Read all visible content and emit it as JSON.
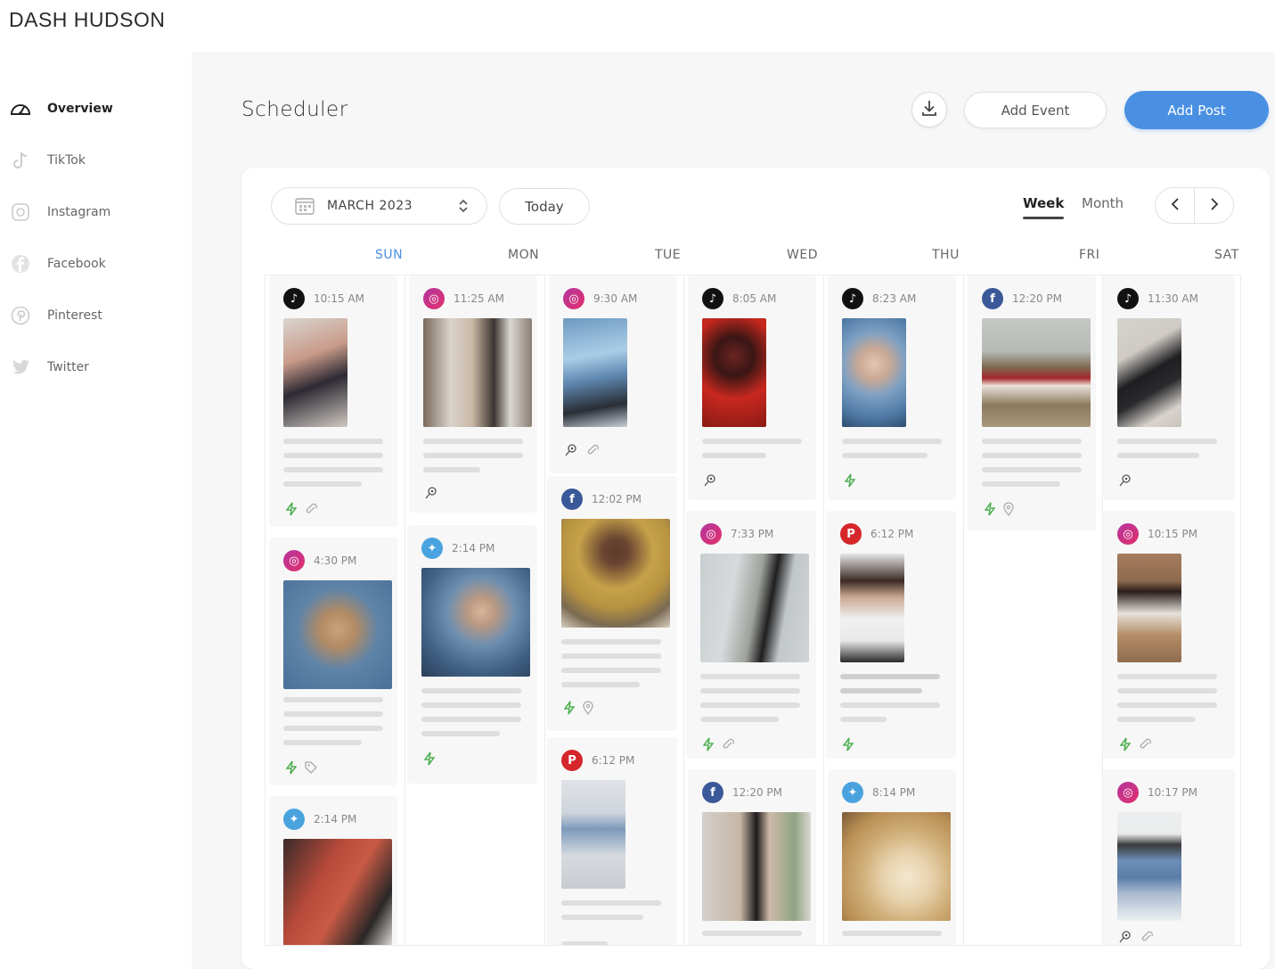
{
  "brand": "DASH HUDSON",
  "colors": {
    "accent": "#4a90e2",
    "tiktok": "#111111",
    "instagram": "#c13584",
    "facebook": "#3b5998",
    "twitter": "#4aa3df",
    "pinterest": "#d5262c",
    "boost": "#4caf50"
  },
  "sidebar": {
    "items": [
      {
        "label": "Overview",
        "icon": "dashboard-gauge-icon"
      },
      {
        "label": "TikTok",
        "icon": "tiktok-icon"
      },
      {
        "label": "Instagram",
        "icon": "instagram-icon"
      },
      {
        "label": "Facebook",
        "icon": "facebook-icon"
      },
      {
        "label": "Pinterest",
        "icon": "pinterest-icon"
      },
      {
        "label": "Twitter",
        "icon": "twitter-icon"
      }
    ]
  },
  "header": {
    "title": "Scheduler",
    "download_icon": "download-icon",
    "add_event": "Add Event",
    "add_post": "Add Post"
  },
  "toolbar": {
    "month": "MARCH 2023",
    "today": "Today",
    "week": "Week",
    "month_view": "Month"
  },
  "days": [
    "SUN",
    "MON",
    "TUE",
    "WED",
    "THU",
    "FRI",
    "SAT"
  ],
  "posts": {
    "sun": [
      {
        "platform": "tiktok",
        "time": "10:15 AM",
        "image": "couple-fashion-photo"
      },
      {
        "platform": "instagram",
        "time": "4:30 PM",
        "image": "man-in-bucket-hat-photo"
      },
      {
        "platform": "twitter",
        "time": "2:14 PM",
        "image": "woman-browsing-rack-photo"
      }
    ],
    "mon": [
      {
        "platform": "instagram",
        "time": "11:25 AM",
        "image": "clothing-rack-photo"
      },
      {
        "platform": "twitter",
        "time": "2:14 PM",
        "image": "woman-puffer-jacket-photo"
      }
    ],
    "tue": [
      {
        "platform": "instagram",
        "time": "9:30 AM",
        "image": "man-seated-chair-photo"
      },
      {
        "platform": "facebook",
        "time": "12:02 PM",
        "image": "man-yellow-sweater-photo"
      },
      {
        "platform": "pinterest",
        "time": "6:12 PM",
        "image": "handstand-jeans-photo"
      }
    ],
    "wed": [
      {
        "platform": "tiktok",
        "time": "8:05 AM",
        "image": "woman-red-light-photo"
      },
      {
        "platform": "instagram",
        "time": "7:33 PM",
        "image": "woman-trench-coat-photo"
      },
      {
        "platform": "facebook",
        "time": "12:20 PM",
        "image": "woman-black-dress-photo"
      }
    ],
    "thu": [
      {
        "platform": "tiktok",
        "time": "8:23 AM",
        "image": "woman-hood-portrait-photo"
      },
      {
        "platform": "pinterest",
        "time": "6:12 PM",
        "image": "woman-crouching-photo"
      },
      {
        "platform": "twitter",
        "time": "8:14 PM",
        "image": "gold-necklace-photo"
      }
    ],
    "fri": [
      {
        "platform": "facebook",
        "time": "12:20 PM",
        "image": "two-women-beach-photo"
      }
    ],
    "sat": [
      {
        "platform": "tiktok",
        "time": "11:30 AM",
        "image": "black-outfit-pose-photo"
      },
      {
        "platform": "instagram",
        "time": "10:15 PM",
        "image": "woman-seated-brown-photo"
      },
      {
        "platform": "instagram",
        "time": "10:17 PM",
        "image": "woman-denim-jacket-photo"
      }
    ]
  }
}
